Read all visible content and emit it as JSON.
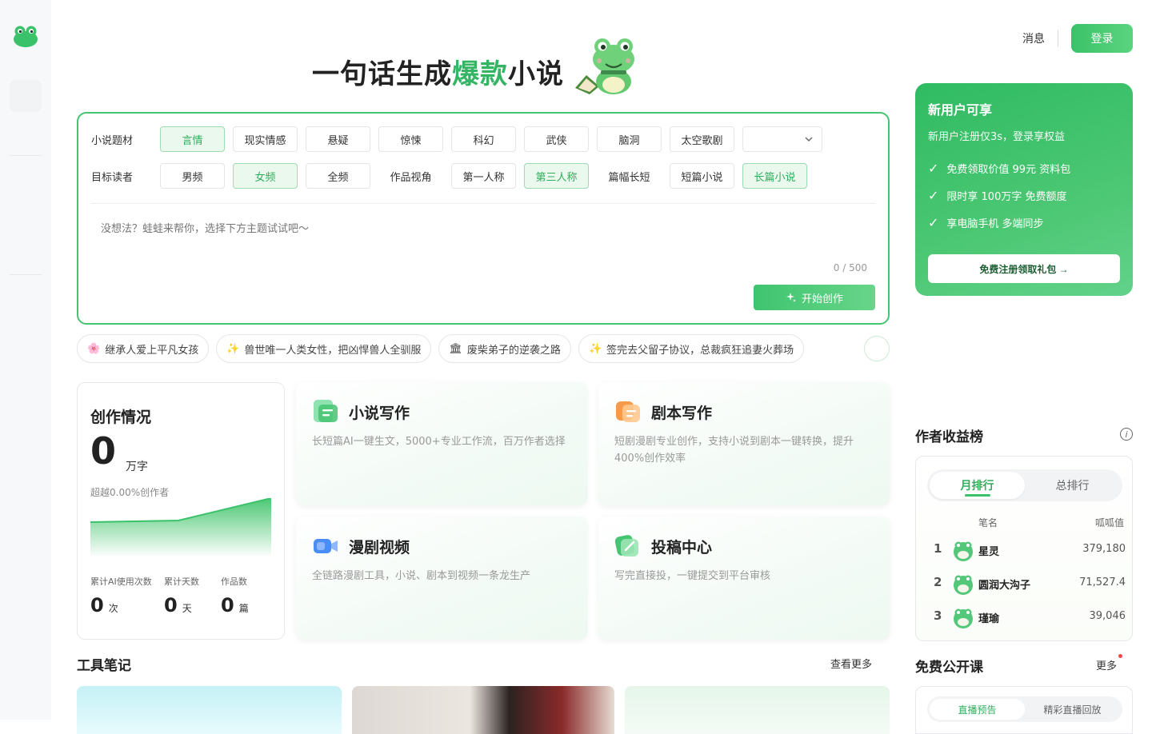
{
  "header": {
    "messages_label": "消息",
    "login_label": "登录"
  },
  "hero": {
    "title_prefix": "一句话生成",
    "title_highlight": "爆款",
    "title_suffix": "小说"
  },
  "composer": {
    "genre_label": "小说题材",
    "genres": [
      "言情",
      "现实情感",
      "悬疑",
      "惊悚",
      "科幻",
      "武侠",
      "脑洞",
      "太空歌剧"
    ],
    "genre_selected": "言情",
    "reader_label": "目标读者",
    "readers": [
      "男频",
      "女频",
      "全频"
    ],
    "reader_selected": "女频",
    "pov_label": "作品视角",
    "povs": [
      "第一人称",
      "第三人称"
    ],
    "pov_selected": "第三人称",
    "length_label": "篇幅长短",
    "lengths": [
      "短篇小说",
      "长篇小说"
    ],
    "length_selected": "长篇小说",
    "placeholder": "没想法？蛙蛙来帮你，选择下方主题试试吧～",
    "counter": "0 / 500",
    "start_label": "开始创作"
  },
  "suggestions": [
    {
      "icon": "🌸",
      "text": "继承人爱上平凡女孩"
    },
    {
      "icon": "✨",
      "text": "兽世唯一人类女性，把凶悍兽人全驯服"
    },
    {
      "icon": "🏛",
      "text": "废柴弟子的逆袭之路"
    },
    {
      "icon": "✨",
      "text": "签完去父留子协议，总裁疯狂追妻火葬场"
    }
  ],
  "stats": {
    "title": "创作情况",
    "words": "0",
    "words_unit": "万字",
    "rank_text": "超越0.00%创作者",
    "metrics": [
      {
        "label": "累计AI使用次数",
        "value": "0",
        "unit": "次"
      },
      {
        "label": "累计天数",
        "value": "0",
        "unit": "天"
      },
      {
        "label": "作品数",
        "value": "0",
        "unit": "篇"
      }
    ]
  },
  "features": [
    {
      "title": "小说写作",
      "desc": "长短篇AI一键生文，5000+专业工作流，百万作者选择"
    },
    {
      "title": "剧本写作",
      "desc": "短剧漫剧专业创作，支持小说到剧本一键转换，提升400%创作效率"
    },
    {
      "title": "漫剧视频",
      "desc": "全链路漫剧工具，小说、剧本到视频一条龙生产"
    },
    {
      "title": "投稿中心",
      "desc": "写完直接投，一键提交到平台审核"
    }
  ],
  "notes": {
    "title": "工具笔记",
    "more": "查看更多"
  },
  "promo": {
    "title": "新用户可享",
    "subtitle": "新用户注册仅3s，登录享权益",
    "items": [
      "免费领取价值 99元 资料包",
      "限时享 100万字 免费额度",
      "享电脑手机 多端同步"
    ],
    "button": "免费注册领取礼包 →"
  },
  "board": {
    "title": "作者收益榜",
    "tabs": [
      "月排行",
      "总排行"
    ],
    "active_tab": "月排行",
    "col_name": "笔名",
    "col_score": "呱呱值",
    "rows": [
      {
        "rank": "1",
        "name": "星灵",
        "score": "379,180"
      },
      {
        "rank": "2",
        "name": "圆润大沟子",
        "score": "71,527.4"
      },
      {
        "rank": "3",
        "name": "瑾瑜",
        "score": "39,046"
      }
    ]
  },
  "classes": {
    "title": "免费公开课",
    "more": "更多",
    "tabs": [
      "直播预告",
      "精彩直播回放"
    ]
  },
  "colors": {
    "accent": "#3ac26a",
    "accent_text": "#2fae5c",
    "border_green": "#45c472"
  }
}
